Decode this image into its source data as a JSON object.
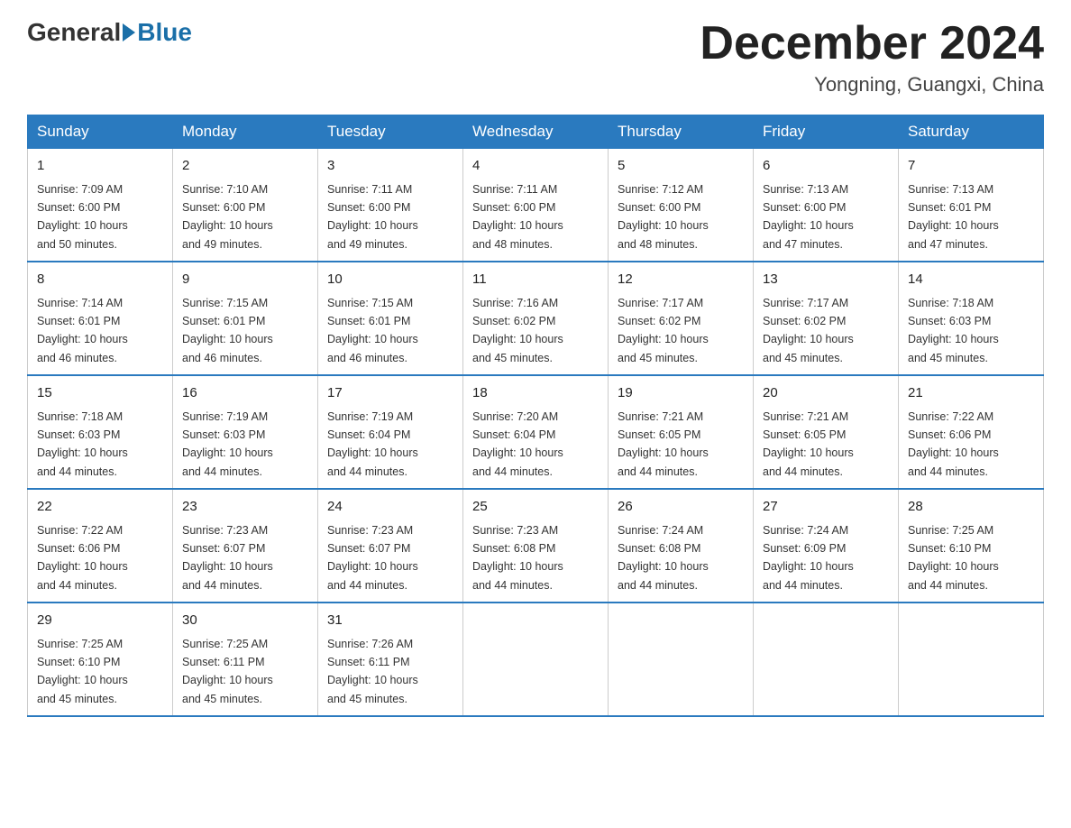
{
  "logo": {
    "general": "General",
    "blue": "Blue"
  },
  "title": "December 2024",
  "location": "Yongning, Guangxi, China",
  "days_of_week": [
    "Sunday",
    "Monday",
    "Tuesday",
    "Wednesday",
    "Thursday",
    "Friday",
    "Saturday"
  ],
  "weeks": [
    [
      {
        "day": "1",
        "sunrise": "7:09 AM",
        "sunset": "6:00 PM",
        "daylight": "10 hours and 50 minutes."
      },
      {
        "day": "2",
        "sunrise": "7:10 AM",
        "sunset": "6:00 PM",
        "daylight": "10 hours and 49 minutes."
      },
      {
        "day": "3",
        "sunrise": "7:11 AM",
        "sunset": "6:00 PM",
        "daylight": "10 hours and 49 minutes."
      },
      {
        "day": "4",
        "sunrise": "7:11 AM",
        "sunset": "6:00 PM",
        "daylight": "10 hours and 48 minutes."
      },
      {
        "day": "5",
        "sunrise": "7:12 AM",
        "sunset": "6:00 PM",
        "daylight": "10 hours and 48 minutes."
      },
      {
        "day": "6",
        "sunrise": "7:13 AM",
        "sunset": "6:00 PM",
        "daylight": "10 hours and 47 minutes."
      },
      {
        "day": "7",
        "sunrise": "7:13 AM",
        "sunset": "6:01 PM",
        "daylight": "10 hours and 47 minutes."
      }
    ],
    [
      {
        "day": "8",
        "sunrise": "7:14 AM",
        "sunset": "6:01 PM",
        "daylight": "10 hours and 46 minutes."
      },
      {
        "day": "9",
        "sunrise": "7:15 AM",
        "sunset": "6:01 PM",
        "daylight": "10 hours and 46 minutes."
      },
      {
        "day": "10",
        "sunrise": "7:15 AM",
        "sunset": "6:01 PM",
        "daylight": "10 hours and 46 minutes."
      },
      {
        "day": "11",
        "sunrise": "7:16 AM",
        "sunset": "6:02 PM",
        "daylight": "10 hours and 45 minutes."
      },
      {
        "day": "12",
        "sunrise": "7:17 AM",
        "sunset": "6:02 PM",
        "daylight": "10 hours and 45 minutes."
      },
      {
        "day": "13",
        "sunrise": "7:17 AM",
        "sunset": "6:02 PM",
        "daylight": "10 hours and 45 minutes."
      },
      {
        "day": "14",
        "sunrise": "7:18 AM",
        "sunset": "6:03 PM",
        "daylight": "10 hours and 45 minutes."
      }
    ],
    [
      {
        "day": "15",
        "sunrise": "7:18 AM",
        "sunset": "6:03 PM",
        "daylight": "10 hours and 44 minutes."
      },
      {
        "day": "16",
        "sunrise": "7:19 AM",
        "sunset": "6:03 PM",
        "daylight": "10 hours and 44 minutes."
      },
      {
        "day": "17",
        "sunrise": "7:19 AM",
        "sunset": "6:04 PM",
        "daylight": "10 hours and 44 minutes."
      },
      {
        "day": "18",
        "sunrise": "7:20 AM",
        "sunset": "6:04 PM",
        "daylight": "10 hours and 44 minutes."
      },
      {
        "day": "19",
        "sunrise": "7:21 AM",
        "sunset": "6:05 PM",
        "daylight": "10 hours and 44 minutes."
      },
      {
        "day": "20",
        "sunrise": "7:21 AM",
        "sunset": "6:05 PM",
        "daylight": "10 hours and 44 minutes."
      },
      {
        "day": "21",
        "sunrise": "7:22 AM",
        "sunset": "6:06 PM",
        "daylight": "10 hours and 44 minutes."
      }
    ],
    [
      {
        "day": "22",
        "sunrise": "7:22 AM",
        "sunset": "6:06 PM",
        "daylight": "10 hours and 44 minutes."
      },
      {
        "day": "23",
        "sunrise": "7:23 AM",
        "sunset": "6:07 PM",
        "daylight": "10 hours and 44 minutes."
      },
      {
        "day": "24",
        "sunrise": "7:23 AM",
        "sunset": "6:07 PM",
        "daylight": "10 hours and 44 minutes."
      },
      {
        "day": "25",
        "sunrise": "7:23 AM",
        "sunset": "6:08 PM",
        "daylight": "10 hours and 44 minutes."
      },
      {
        "day": "26",
        "sunrise": "7:24 AM",
        "sunset": "6:08 PM",
        "daylight": "10 hours and 44 minutes."
      },
      {
        "day": "27",
        "sunrise": "7:24 AM",
        "sunset": "6:09 PM",
        "daylight": "10 hours and 44 minutes."
      },
      {
        "day": "28",
        "sunrise": "7:25 AM",
        "sunset": "6:10 PM",
        "daylight": "10 hours and 44 minutes."
      }
    ],
    [
      {
        "day": "29",
        "sunrise": "7:25 AM",
        "sunset": "6:10 PM",
        "daylight": "10 hours and 45 minutes."
      },
      {
        "day": "30",
        "sunrise": "7:25 AM",
        "sunset": "6:11 PM",
        "daylight": "10 hours and 45 minutes."
      },
      {
        "day": "31",
        "sunrise": "7:26 AM",
        "sunset": "6:11 PM",
        "daylight": "10 hours and 45 minutes."
      },
      null,
      null,
      null,
      null
    ]
  ]
}
